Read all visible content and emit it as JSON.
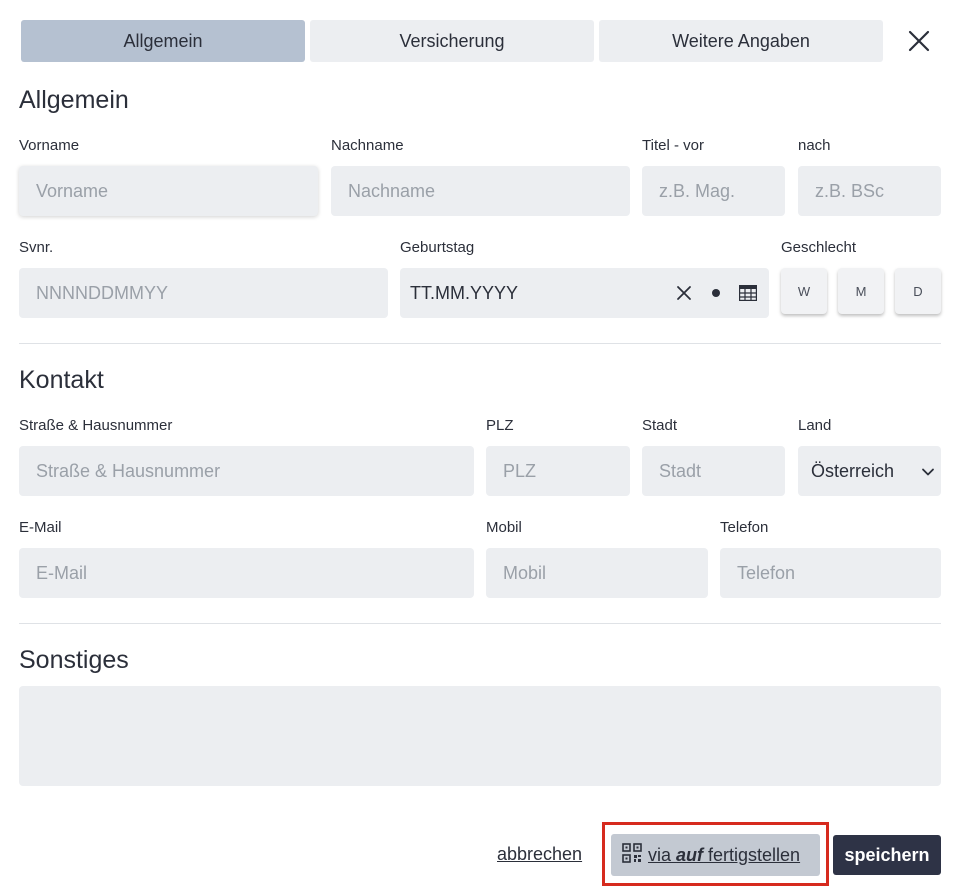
{
  "tabs": [
    "Allgemein",
    "Versicherung",
    "Weitere Angaben"
  ],
  "sections": {
    "general": "Allgemein",
    "contact": "Kontakt",
    "other": "Sonstiges"
  },
  "fields": {
    "vorname": {
      "label": "Vorname",
      "placeholder": "Vorname"
    },
    "nachname": {
      "label": "Nachname",
      "placeholder": "Nachname"
    },
    "titel_vor": {
      "label": "Titel - vor",
      "placeholder": "z.B. Mag."
    },
    "titel_nach": {
      "label": "nach",
      "placeholder": "z.B. BSc"
    },
    "svnr": {
      "label": "Svnr.",
      "placeholder": "NNNNDDMMYY"
    },
    "geburtstag": {
      "label": "Geburtstag",
      "value": "TT.MM.YYYY"
    },
    "geschlecht": {
      "label": "Geschlecht",
      "options": [
        "W",
        "M",
        "D"
      ]
    },
    "strasse": {
      "label": "Straße & Hausnummer",
      "placeholder": "Straße & Hausnummer"
    },
    "plz": {
      "label": "PLZ",
      "placeholder": "PLZ"
    },
    "stadt": {
      "label": "Stadt",
      "placeholder": "Stadt"
    },
    "land": {
      "label": "Land",
      "value": "Österreich"
    },
    "email": {
      "label": "E-Mail",
      "placeholder": "E-Mail"
    },
    "mobil": {
      "label": "Mobil",
      "placeholder": "Mobil"
    },
    "telefon": {
      "label": "Telefon",
      "placeholder": "Telefon"
    }
  },
  "footer": {
    "cancel": "abbrechen",
    "qr_prefix": "via ",
    "qr_brand": "auf",
    "qr_suffix": " fertigstellen",
    "save": "speichern"
  },
  "icons": [
    "close-icon",
    "clear-icon",
    "dot-icon",
    "calendar-icon",
    "chevron-down-icon",
    "qr-code-icon"
  ],
  "colors": {
    "tab_active": "#b5c1d1",
    "field_bg": "#eceef1",
    "primary": "#2e3346",
    "highlight": "#d62a1e"
  }
}
